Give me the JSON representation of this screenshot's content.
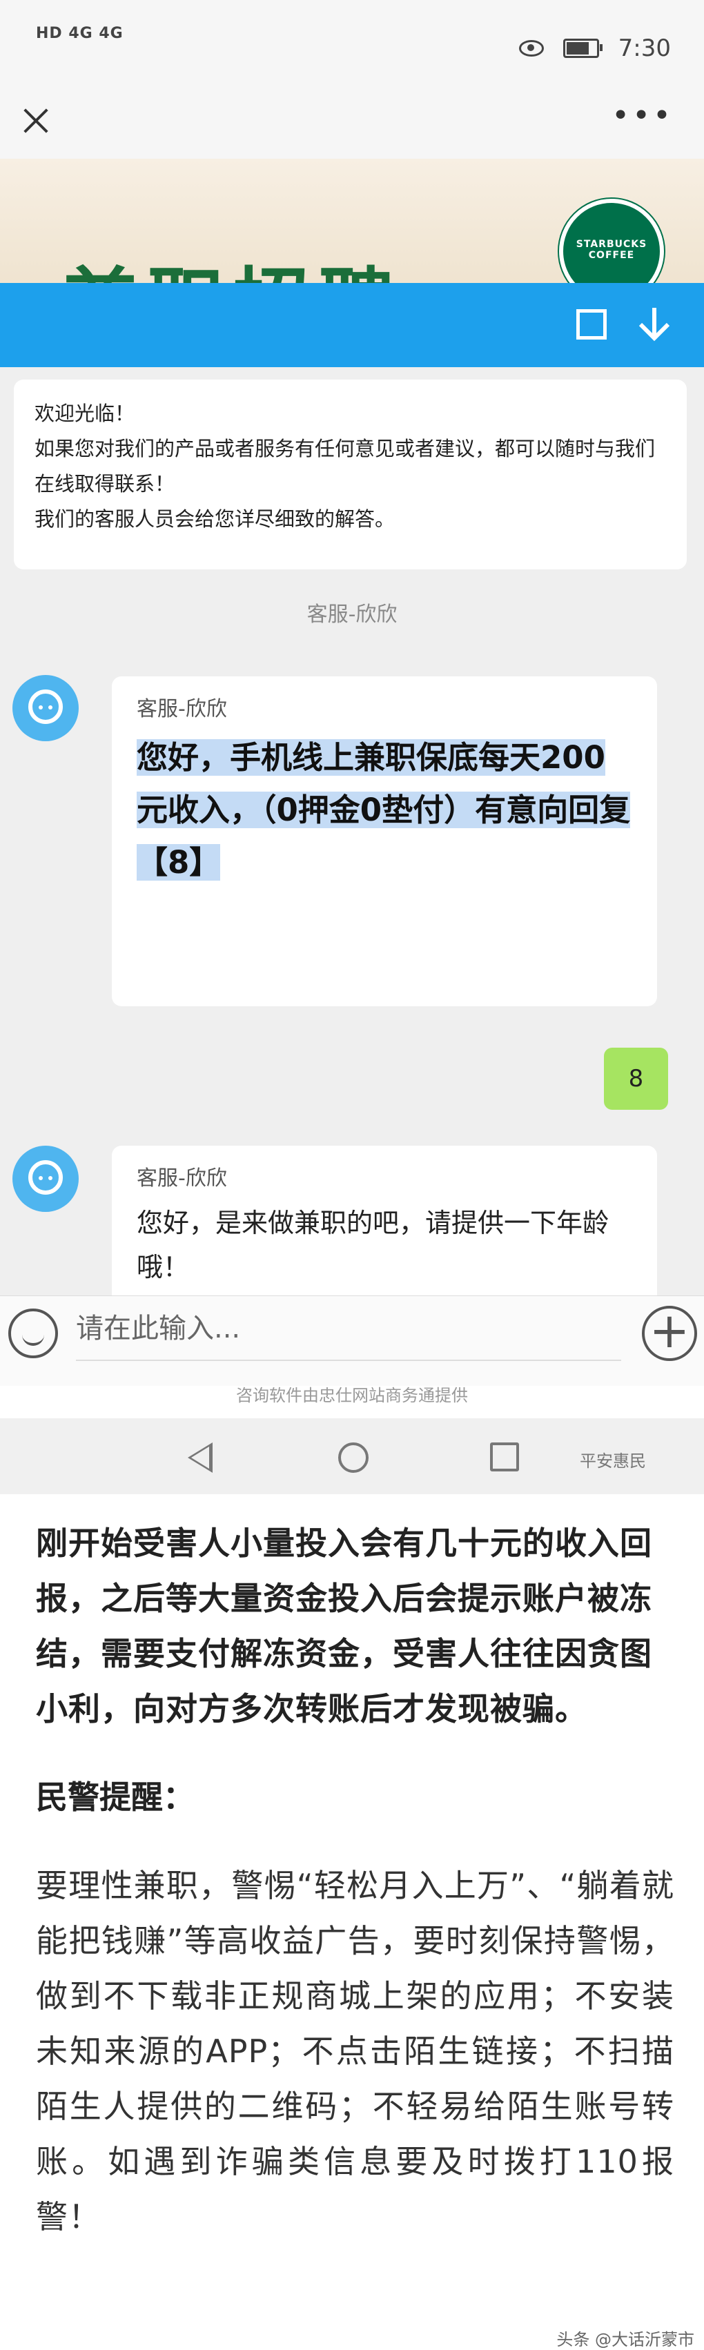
{
  "status_bar": {
    "network": "HD 4G 4G",
    "time": "7:30"
  },
  "banner": {
    "text": "兼职招聘",
    "logo_text": "STARBUCKS COFFEE"
  },
  "chat": {
    "welcome": [
      "欢迎光临！",
      "如果您对我们的产品或者服务有任何意见或者建议，都可以随时与我们在线取得联系！",
      "我们的客服人员会给您详尽细致的解答。"
    ],
    "agent_label": "客服-欣欣",
    "messages": [
      {
        "sender": "客服-欣欣",
        "text": "您好，手机线上兼职保底每天200元收入，（0押金0垫付）有意向回复【8】"
      },
      {
        "sender": "me",
        "text": "8"
      },
      {
        "sender": "客服-欣欣",
        "text": "您好，是来做兼职的吧，请提供一下年龄哦！"
      }
    ],
    "input_placeholder": "请在此输入...",
    "provider_text": "咨询软件由忠仕网站商务通提供"
  },
  "watermark_top": "平安惠民",
  "article": {
    "p1": "刚开始受害人小量投入会有几十元的收入回报，之后等大量资金投入后会提示账户被冻结，需要支付解冻资金，受害人往往因贪图小利，向对方多次转账后才发现被骗。",
    "heading": "民警提醒：",
    "p3": "要理性兼职，警惕“轻松月入上万”、“躺着就能把钱赚”等高收益广告，要时刻保持警惕，做到不下载非正规商城上架的应用；不安装未知来源的APP；不点击陌生链接；不扫描陌生人提供的二维码；不轻易给陌生账号转账。如遇到诈骗类信息要及时拨打110报警！"
  },
  "watermark_bottom": "头条 @大话沂蒙市",
  "colors": {
    "blue_bar": "#1da0ec",
    "my_bubble": "#a6e461",
    "highlight": "#c4dbf5"
  }
}
